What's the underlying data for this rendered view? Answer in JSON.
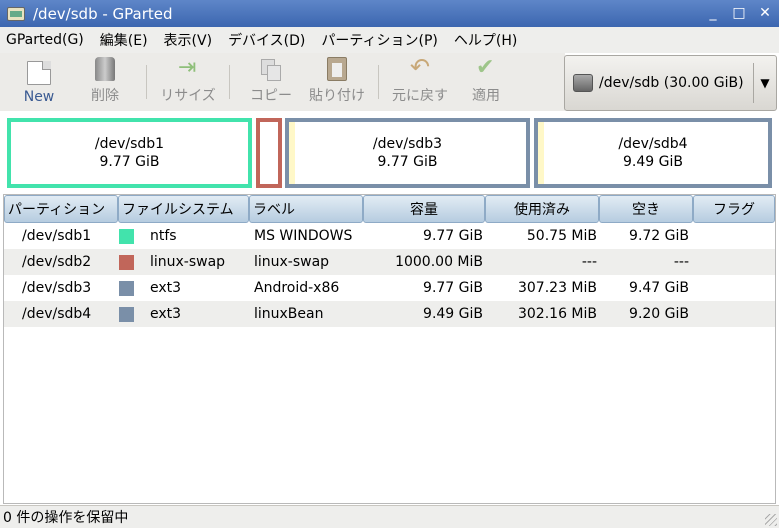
{
  "window": {
    "title": "/dev/sdb - GParted",
    "minimize": "_",
    "maximize": "□",
    "close": "✕"
  },
  "menu": [
    "GParted(G)",
    "編集(E)",
    "表示(V)",
    "デバイス(D)",
    "パーティション(P)",
    "ヘルプ(H)"
  ],
  "toolbar": {
    "new": "New",
    "delete": "削除",
    "resize": "リサイズ",
    "copy": "コピー",
    "paste": "貼り付け",
    "undo": "元に戻す",
    "apply": "適用"
  },
  "device": {
    "label": "/dev/sdb  (30.00 GiB)",
    "arrow": "▼"
  },
  "diskmap": [
    {
      "name": "/dev/sdb1",
      "size": "9.77 GiB",
      "color": "#42e3ac"
    },
    {
      "name": "",
      "size": "",
      "color": "#c1665a"
    },
    {
      "name": "/dev/sdb3",
      "size": "9.77 GiB",
      "color": "#7a8fa8"
    },
    {
      "name": "/dev/sdb4",
      "size": "9.49 GiB",
      "color": "#7a8fa8"
    }
  ],
  "columns": [
    "パーティション",
    "ファイルシステム",
    "ラベル",
    "容量",
    "使用済み",
    "空き",
    "フラグ"
  ],
  "rows": [
    {
      "partition": "/dev/sdb1",
      "fs": "ntfs",
      "fs_color": "#42e3ac",
      "label": "MS WINDOWS",
      "size": "9.77 GiB",
      "used": "50.75 MiB",
      "free": "9.72 GiB",
      "flags": ""
    },
    {
      "partition": "/dev/sdb2",
      "fs": "linux-swap",
      "fs_color": "#c1665a",
      "label": "linux-swap",
      "size": "1000.00 MiB",
      "used": "---",
      "free": "---",
      "flags": ""
    },
    {
      "partition": "/dev/sdb3",
      "fs": "ext3",
      "fs_color": "#7a8fa8",
      "label": "Android-x86",
      "size": "9.77 GiB",
      "used": "307.23 MiB",
      "free": "9.47 GiB",
      "flags": ""
    },
    {
      "partition": "/dev/sdb4",
      "fs": "ext3",
      "fs_color": "#7a8fa8",
      "label": "linuxBean",
      "size": "9.49 GiB",
      "used": "302.16 MiB",
      "free": "9.20 GiB",
      "flags": ""
    }
  ],
  "status": "0 件の操作を保留中"
}
